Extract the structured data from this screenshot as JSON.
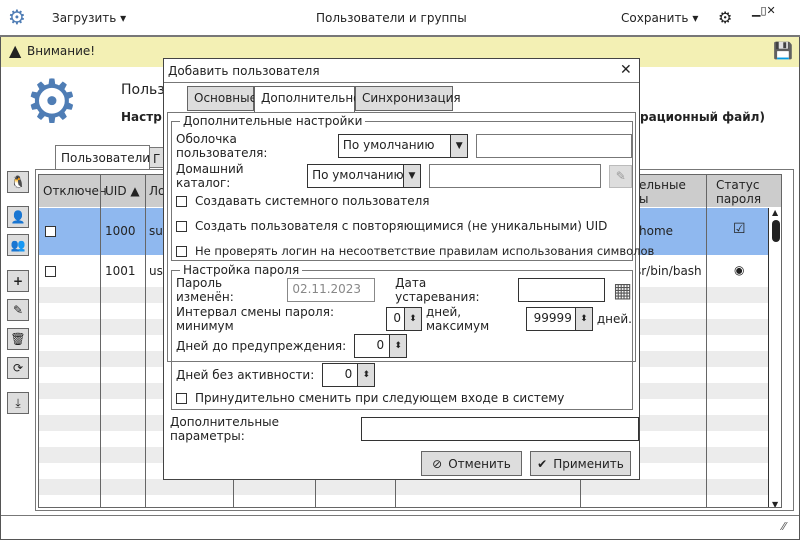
{
  "titlebar": {
    "load_label": "Загрузить",
    "title": "Пользователи и группы",
    "save_label": "Сохранить"
  },
  "warning": {
    "text": "Внимание!"
  },
  "header": {
    "title": "Польз",
    "subtitle": "Настр",
    "subtitle_tail": "рационный файл)"
  },
  "main_tabs": [
    "Пользователи",
    "Г"
  ],
  "table": {
    "columns": [
      "Отключен",
      "UID ▲",
      "Ло",
      "ельные",
      "ы",
      "Статус пароля"
    ],
    "rows": [
      {
        "uid": "1000",
        "login": "su",
        "dir": "home",
        "status": "checked",
        "selected": true
      },
      {
        "uid": "1001",
        "login": "us",
        "dir": "sr/bin/bash",
        "status": "radio",
        "selected": false
      }
    ]
  },
  "dialog": {
    "title": "Добавить пользователя",
    "tabs": [
      "Основные",
      "Дополнительно",
      "Синхронизация"
    ],
    "active_tab": 1,
    "extra": {
      "legend": "Дополнительные настройки",
      "shell_label": "Оболочка пользователя:",
      "shell_value": "По умолчанию",
      "shell_custom": "",
      "home_label": "Домашний каталог:",
      "home_value": "По умолчанию",
      "home_custom": "",
      "cb_system": "Создавать системного пользователя",
      "cb_dup_uid": "Создать пользователя с повторяющимися (не уникальными) UID",
      "cb_nocheck": "Не проверять логин на несоответствие правилам использования символов"
    },
    "password": {
      "legend": "Настройка пароля",
      "changed_label": "Пароль изменён:",
      "changed_value": "02.11.2023",
      "expire_label": "Дата устаревания:",
      "expire_value": "",
      "interval_label": "Интервал смены пароля: минимум",
      "min_value": "0",
      "max_label": "дней, максимум",
      "max_value": "99999",
      "days_label": "дней.",
      "warn_label": "Дней до предупреждения:",
      "warn_value": "0",
      "inactive_label": "Дней без активности:",
      "inactive_value": "0",
      "cb_force": "Принудительно сменить при следующем входе в систему"
    },
    "params_label": "Дополнительные параметры:",
    "params_value": "",
    "cancel": "Отменить",
    "apply": "Применить"
  },
  "colors": {
    "accent": "#4f7db5",
    "selected_row": "#8fb8ef",
    "warning_bg": "#f3f0b4"
  }
}
